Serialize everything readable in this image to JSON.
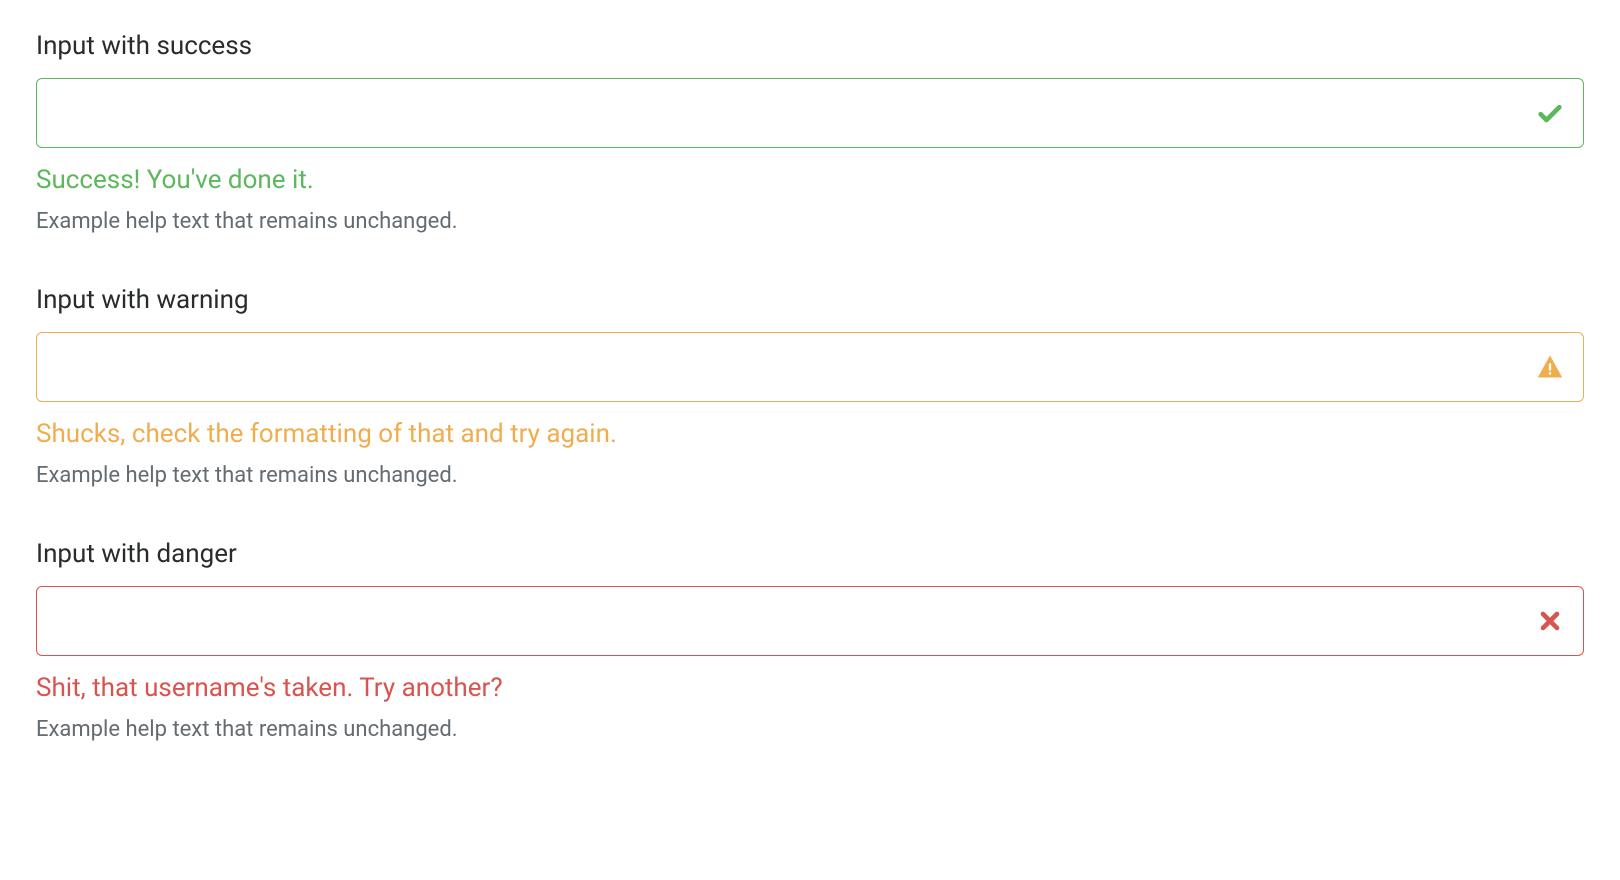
{
  "colors": {
    "success": "#5cb85c",
    "warning": "#f0ad4e",
    "danger": "#d9534f",
    "muted": "#636c72",
    "text": "#292b2c"
  },
  "groups": {
    "success": {
      "label": "Input with success",
      "value": "",
      "placeholder": "",
      "feedback": "Success! You've done it.",
      "help": "Example help text that remains unchanged.",
      "icon": "check"
    },
    "warning": {
      "label": "Input with warning",
      "value": "",
      "placeholder": "",
      "feedback": "Shucks, check the formatting of that and try again.",
      "help": "Example help text that remains unchanged.",
      "icon": "warn-triangle"
    },
    "danger": {
      "label": "Input with danger",
      "value": "",
      "placeholder": "",
      "feedback": "Shit, that username's taken. Try another?",
      "help": "Example help text that remains unchanged.",
      "icon": "x"
    }
  }
}
